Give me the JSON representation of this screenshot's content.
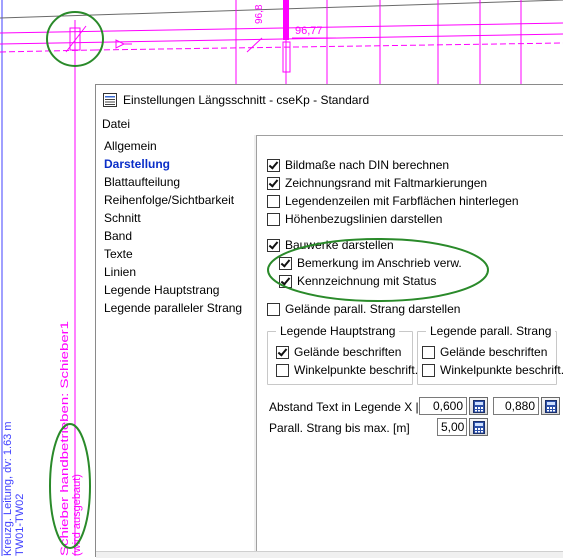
{
  "cad": {
    "dim_label_1": "96,77",
    "dim_label_2": "96,8",
    "vertical_text_1": "Kreuzg. Leitung, dv: 1.63 m",
    "vertical_text_2": "TW01-TW02",
    "vertical_text_3": "Schieber handbetrieben: Schieber1",
    "vertical_text_4": "(wird ausgebaut)"
  },
  "dialog": {
    "title": "Einstellungen Längsschnitt - cseKp - Standard",
    "menu": [
      "Datei"
    ]
  },
  "nav": {
    "items": [
      {
        "label": "Allgemein",
        "active": false
      },
      {
        "label": "Darstellung",
        "active": true
      },
      {
        "label": "Blattaufteilung",
        "active": false
      },
      {
        "label": "Reihenfolge/Sichtbarkeit",
        "active": false
      },
      {
        "label": "Schnitt",
        "active": false
      },
      {
        "label": "Band",
        "active": false
      },
      {
        "label": "Texte",
        "active": false
      },
      {
        "label": "Linien",
        "active": false
      },
      {
        "label": "Legende Hauptstrang",
        "active": false
      },
      {
        "label": "Legende paralleler Strang",
        "active": false
      }
    ]
  },
  "options": {
    "bildmasse": {
      "label": "Bildmaße nach DIN berechnen",
      "checked": true
    },
    "zeichnungsrand": {
      "label": "Zeichnungsrand mit Faltmarkierungen",
      "checked": true
    },
    "legendenzeilen": {
      "label": "Legendenzeilen mit Farbflächen hinterlegen",
      "checked": false
    },
    "hoehenbezug": {
      "label": "Höhenbezugslinien darstellen",
      "checked": false
    },
    "bauwerke": {
      "label": "Bauwerke darstellen",
      "checked": true
    },
    "bemerkung": {
      "label": "Bemerkung im Anschrieb verw.",
      "checked": true
    },
    "kennzeichnung": {
      "label": "Kennzeichnung mit Status",
      "checked": true
    },
    "gelaende_parallel": {
      "label": "Gelände parall. Strang darstellen",
      "checked": false
    }
  },
  "group_haupt": {
    "title": "Legende Hauptstrang",
    "gelaende": {
      "label": "Gelände beschriften",
      "checked": true
    },
    "winkel": {
      "label": "Winkelpunkte beschrift.",
      "checked": false
    }
  },
  "group_parallel": {
    "title": "Legende parall. Strang",
    "gelaende": {
      "label": "Gelände beschriften",
      "checked": false
    },
    "winkel": {
      "label": "Winkelpunkte beschrift.",
      "checked": false
    }
  },
  "fields": {
    "abstand_label": "Abstand Text in Legende X | Y:",
    "abstand_x": "0,600",
    "abstand_y": "0,880",
    "parall_label": "Parall. Strang bis max. [m]",
    "parall_value": "5,00"
  },
  "colors": {
    "magenta": "#ff00ff",
    "highlight_ellipse": "#2a8a2a",
    "active_nav": "#0a2ec8",
    "blue_line": "#4040ff"
  }
}
